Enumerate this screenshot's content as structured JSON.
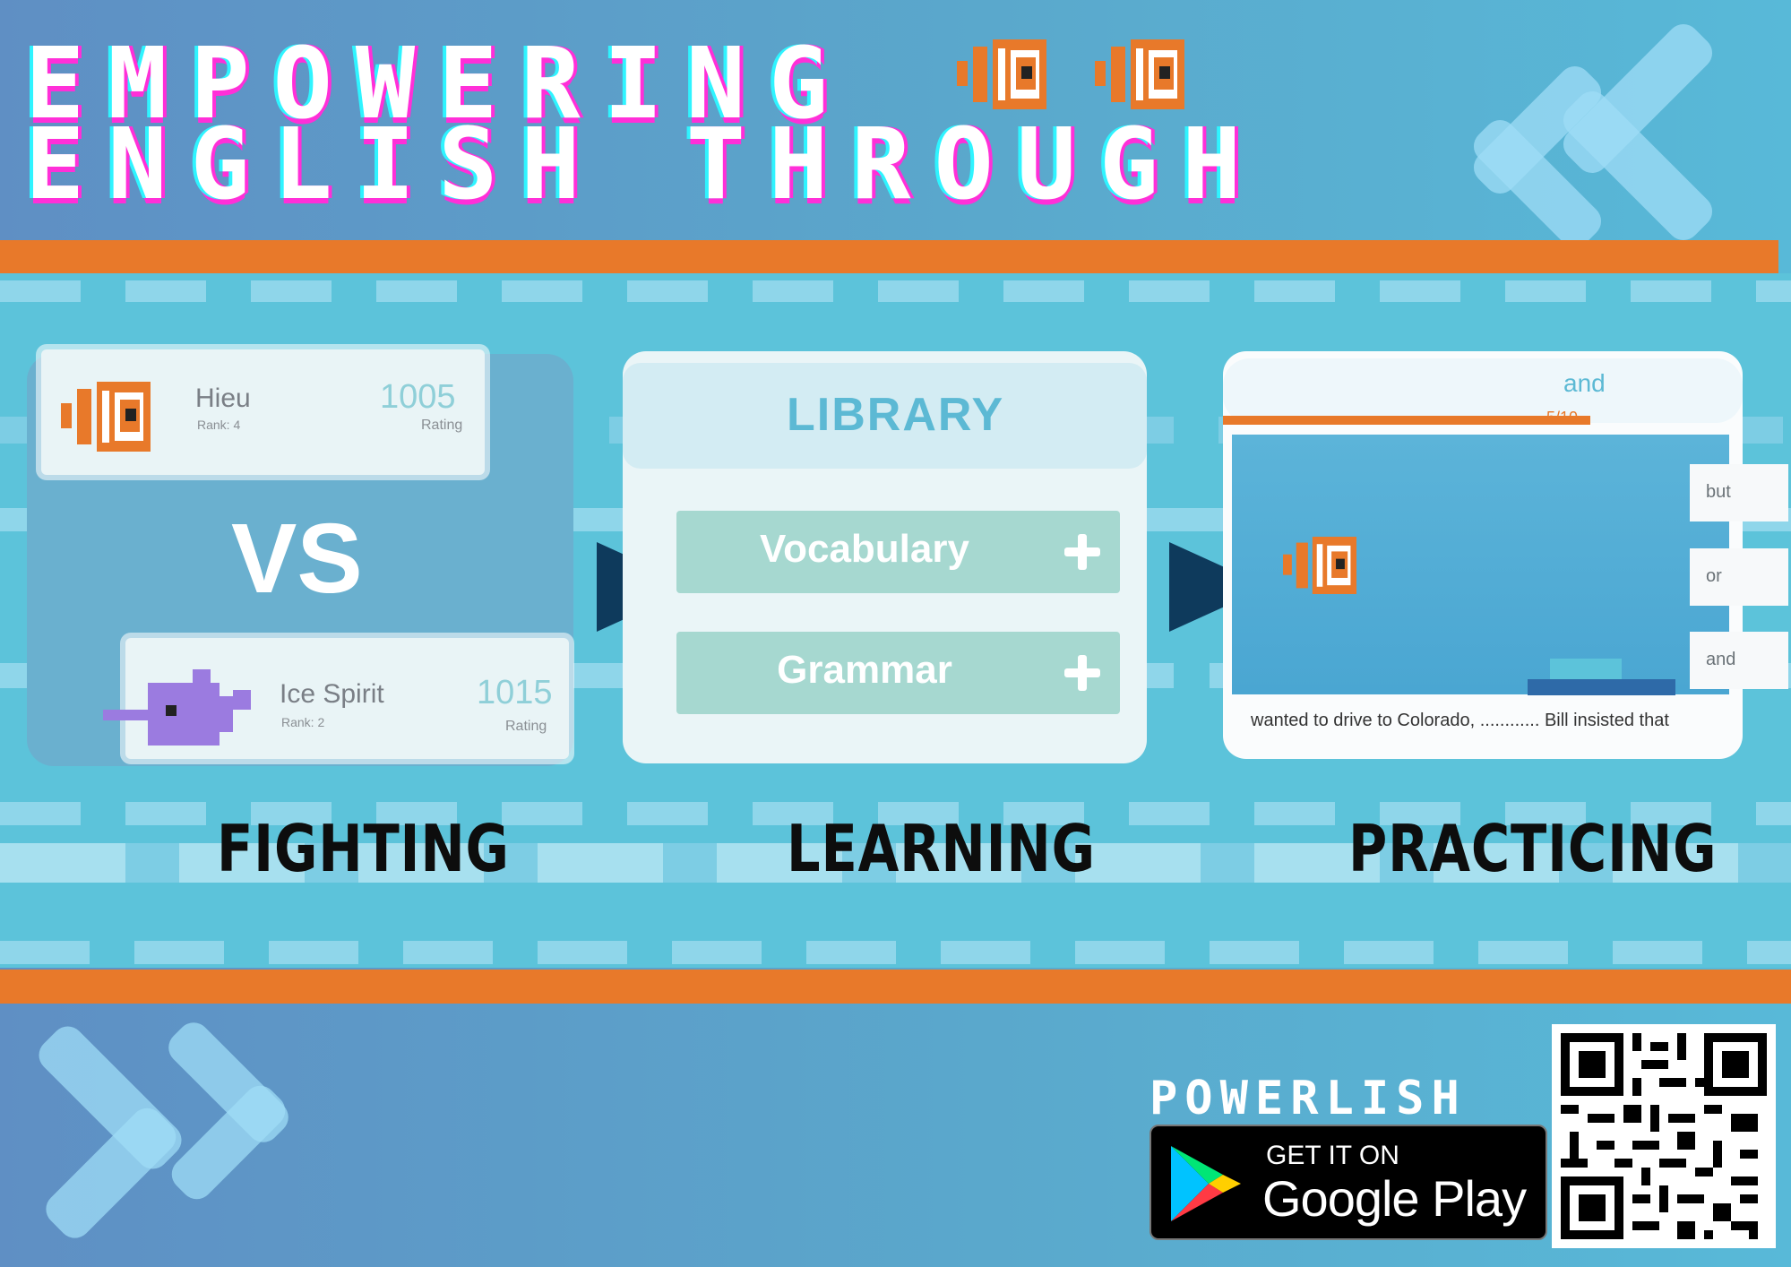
{
  "header": {
    "title_line1": "EMPOWERING",
    "title_line2": "ENGLISH THROUGH"
  },
  "fighting": {
    "player1": {
      "name": "Hieu",
      "rank": "Rank: 4",
      "rating": "1005",
      "rating_label": "Rating"
    },
    "vs": "VS",
    "player2": {
      "name": "Ice Spirit",
      "rank": "Rank: 2",
      "rating": "1015",
      "rating_label": "Rating"
    }
  },
  "library": {
    "title": "LIBRARY",
    "buttons": [
      {
        "label": "Vocabulary"
      },
      {
        "label": "Grammar"
      }
    ]
  },
  "practice": {
    "word": "and",
    "progress": "5/10",
    "choices": [
      {
        "label": "but"
      },
      {
        "label": "or"
      },
      {
        "label": "and"
      }
    ],
    "sentence": "wanted to drive to Colorado, ............ Bill insisted that"
  },
  "steps": {
    "fighting": "FIGHTING",
    "learning": "LEARNING",
    "practicing": "PRACTICING"
  },
  "footer": {
    "brand": "POWERLISH",
    "store_small": "GET IT ON",
    "store_big": "Google Play"
  },
  "colors": {
    "orange": "#e8792a",
    "cyan": "#5cc3da",
    "navy_arrow": "#0e3a5c",
    "title_shadow_pink": "#ff2fd8"
  }
}
